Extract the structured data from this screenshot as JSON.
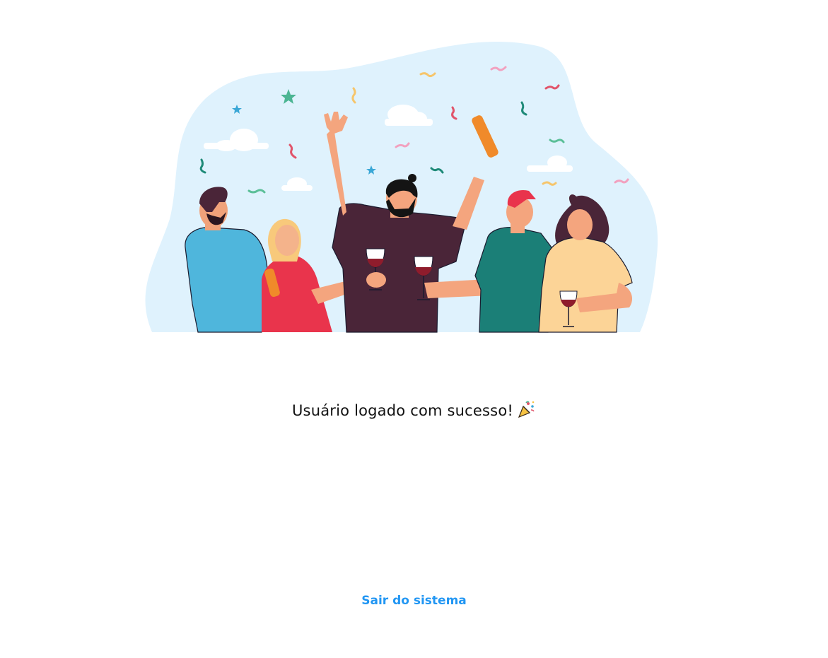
{
  "illustration": {
    "name": "party-celebration-illustration"
  },
  "message": {
    "text": "Usuário logado com sucesso!",
    "emoji_icon": "party-popper-icon"
  },
  "logout": {
    "label": "Sair do sistema"
  },
  "colors": {
    "link": "#2196f3",
    "text": "#111111",
    "blob": "#dff2fd"
  }
}
